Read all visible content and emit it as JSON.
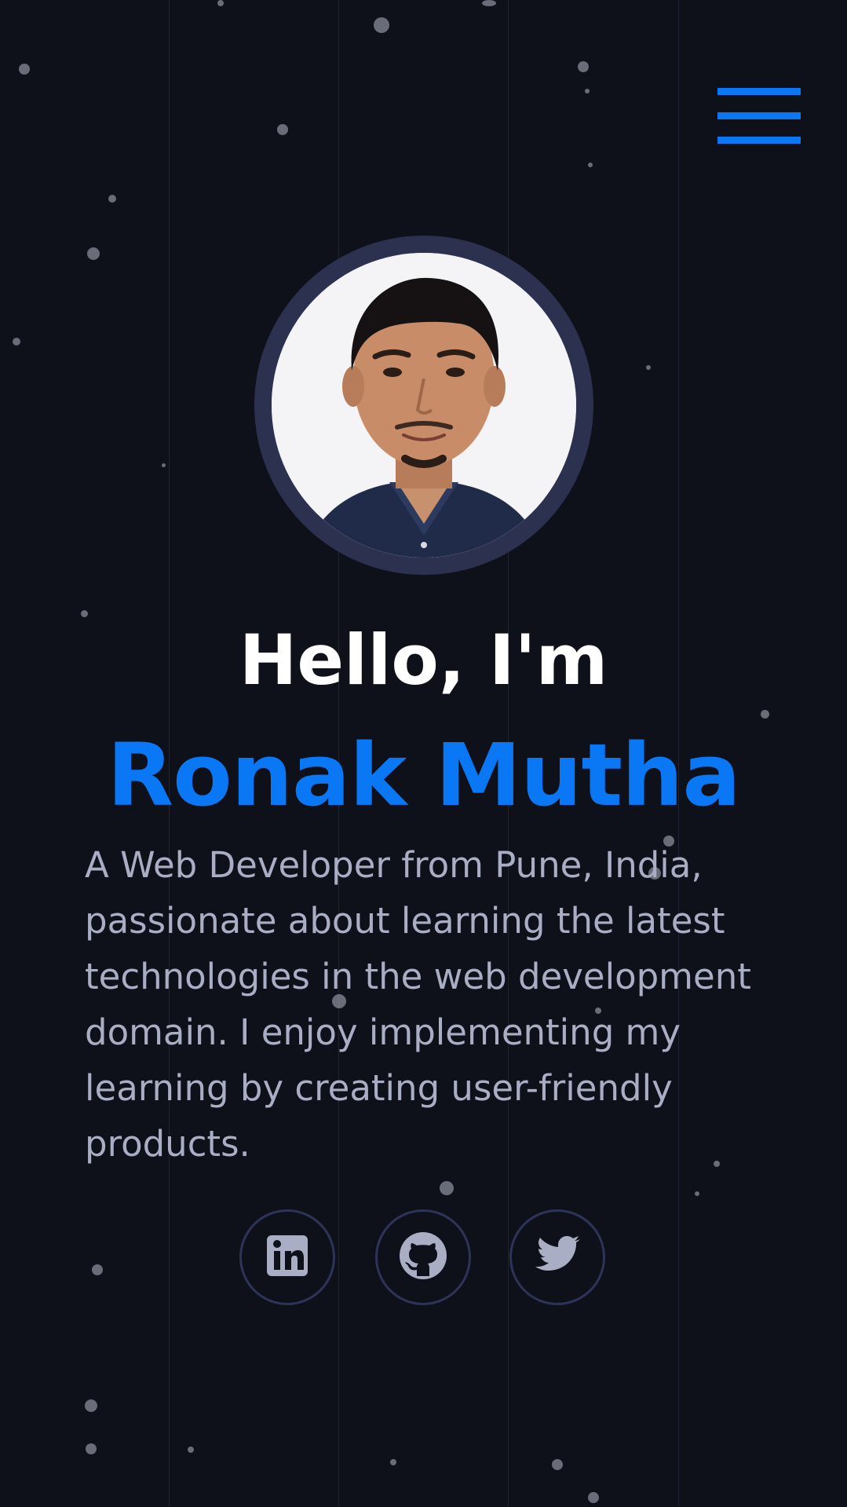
{
  "header": {
    "menu_icon": "hamburger-menu-icon",
    "accent_color": "#0a78f5"
  },
  "hero": {
    "avatar_icon": "profile-photo",
    "greeting": "Hello, I'm",
    "name": "Ronak Mutha",
    "bio": "A Web Developer from Pune, India, passionate about learning the latest technologies in the web development domain. I enjoy implementing my learning by creating user-friendly products."
  },
  "social": [
    {
      "icon": "linkedin-icon"
    },
    {
      "icon": "github-icon"
    },
    {
      "icon": "twitter-icon"
    }
  ],
  "colors": {
    "background": "#0f111a",
    "text_primary": "#ffffff",
    "text_secondary": "#a9aec4",
    "ring": "#2c3150"
  }
}
